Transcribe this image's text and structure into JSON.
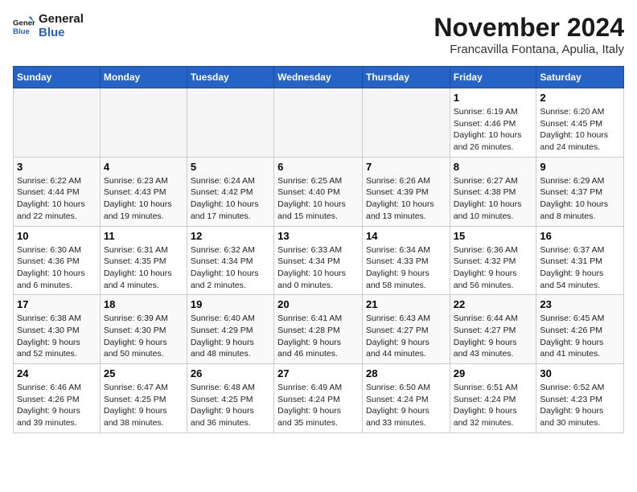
{
  "header": {
    "logo_general": "General",
    "logo_blue": "Blue",
    "month": "November 2024",
    "location": "Francavilla Fontana, Apulia, Italy"
  },
  "weekdays": [
    "Sunday",
    "Monday",
    "Tuesday",
    "Wednesday",
    "Thursday",
    "Friday",
    "Saturday"
  ],
  "weeks": [
    [
      {
        "day": "",
        "info": ""
      },
      {
        "day": "",
        "info": ""
      },
      {
        "day": "",
        "info": ""
      },
      {
        "day": "",
        "info": ""
      },
      {
        "day": "",
        "info": ""
      },
      {
        "day": "1",
        "info": "Sunrise: 6:19 AM\nSunset: 4:46 PM\nDaylight: 10 hours\nand 26 minutes."
      },
      {
        "day": "2",
        "info": "Sunrise: 6:20 AM\nSunset: 4:45 PM\nDaylight: 10 hours\nand 24 minutes."
      }
    ],
    [
      {
        "day": "3",
        "info": "Sunrise: 6:22 AM\nSunset: 4:44 PM\nDaylight: 10 hours\nand 22 minutes."
      },
      {
        "day": "4",
        "info": "Sunrise: 6:23 AM\nSunset: 4:43 PM\nDaylight: 10 hours\nand 19 minutes."
      },
      {
        "day": "5",
        "info": "Sunrise: 6:24 AM\nSunset: 4:42 PM\nDaylight: 10 hours\nand 17 minutes."
      },
      {
        "day": "6",
        "info": "Sunrise: 6:25 AM\nSunset: 4:40 PM\nDaylight: 10 hours\nand 15 minutes."
      },
      {
        "day": "7",
        "info": "Sunrise: 6:26 AM\nSunset: 4:39 PM\nDaylight: 10 hours\nand 13 minutes."
      },
      {
        "day": "8",
        "info": "Sunrise: 6:27 AM\nSunset: 4:38 PM\nDaylight: 10 hours\nand 10 minutes."
      },
      {
        "day": "9",
        "info": "Sunrise: 6:29 AM\nSunset: 4:37 PM\nDaylight: 10 hours\nand 8 minutes."
      }
    ],
    [
      {
        "day": "10",
        "info": "Sunrise: 6:30 AM\nSunset: 4:36 PM\nDaylight: 10 hours\nand 6 minutes."
      },
      {
        "day": "11",
        "info": "Sunrise: 6:31 AM\nSunset: 4:35 PM\nDaylight: 10 hours\nand 4 minutes."
      },
      {
        "day": "12",
        "info": "Sunrise: 6:32 AM\nSunset: 4:34 PM\nDaylight: 10 hours\nand 2 minutes."
      },
      {
        "day": "13",
        "info": "Sunrise: 6:33 AM\nSunset: 4:34 PM\nDaylight: 10 hours\nand 0 minutes."
      },
      {
        "day": "14",
        "info": "Sunrise: 6:34 AM\nSunset: 4:33 PM\nDaylight: 9 hours\nand 58 minutes."
      },
      {
        "day": "15",
        "info": "Sunrise: 6:36 AM\nSunset: 4:32 PM\nDaylight: 9 hours\nand 56 minutes."
      },
      {
        "day": "16",
        "info": "Sunrise: 6:37 AM\nSunset: 4:31 PM\nDaylight: 9 hours\nand 54 minutes."
      }
    ],
    [
      {
        "day": "17",
        "info": "Sunrise: 6:38 AM\nSunset: 4:30 PM\nDaylight: 9 hours\nand 52 minutes."
      },
      {
        "day": "18",
        "info": "Sunrise: 6:39 AM\nSunset: 4:30 PM\nDaylight: 9 hours\nand 50 minutes."
      },
      {
        "day": "19",
        "info": "Sunrise: 6:40 AM\nSunset: 4:29 PM\nDaylight: 9 hours\nand 48 minutes."
      },
      {
        "day": "20",
        "info": "Sunrise: 6:41 AM\nSunset: 4:28 PM\nDaylight: 9 hours\nand 46 minutes."
      },
      {
        "day": "21",
        "info": "Sunrise: 6:43 AM\nSunset: 4:27 PM\nDaylight: 9 hours\nand 44 minutes."
      },
      {
        "day": "22",
        "info": "Sunrise: 6:44 AM\nSunset: 4:27 PM\nDaylight: 9 hours\nand 43 minutes."
      },
      {
        "day": "23",
        "info": "Sunrise: 6:45 AM\nSunset: 4:26 PM\nDaylight: 9 hours\nand 41 minutes."
      }
    ],
    [
      {
        "day": "24",
        "info": "Sunrise: 6:46 AM\nSunset: 4:26 PM\nDaylight: 9 hours\nand 39 minutes."
      },
      {
        "day": "25",
        "info": "Sunrise: 6:47 AM\nSunset: 4:25 PM\nDaylight: 9 hours\nand 38 minutes."
      },
      {
        "day": "26",
        "info": "Sunrise: 6:48 AM\nSunset: 4:25 PM\nDaylight: 9 hours\nand 36 minutes."
      },
      {
        "day": "27",
        "info": "Sunrise: 6:49 AM\nSunset: 4:24 PM\nDaylight: 9 hours\nand 35 minutes."
      },
      {
        "day": "28",
        "info": "Sunrise: 6:50 AM\nSunset: 4:24 PM\nDaylight: 9 hours\nand 33 minutes."
      },
      {
        "day": "29",
        "info": "Sunrise: 6:51 AM\nSunset: 4:24 PM\nDaylight: 9 hours\nand 32 minutes."
      },
      {
        "day": "30",
        "info": "Sunrise: 6:52 AM\nSunset: 4:23 PM\nDaylight: 9 hours\nand 30 minutes."
      }
    ]
  ]
}
